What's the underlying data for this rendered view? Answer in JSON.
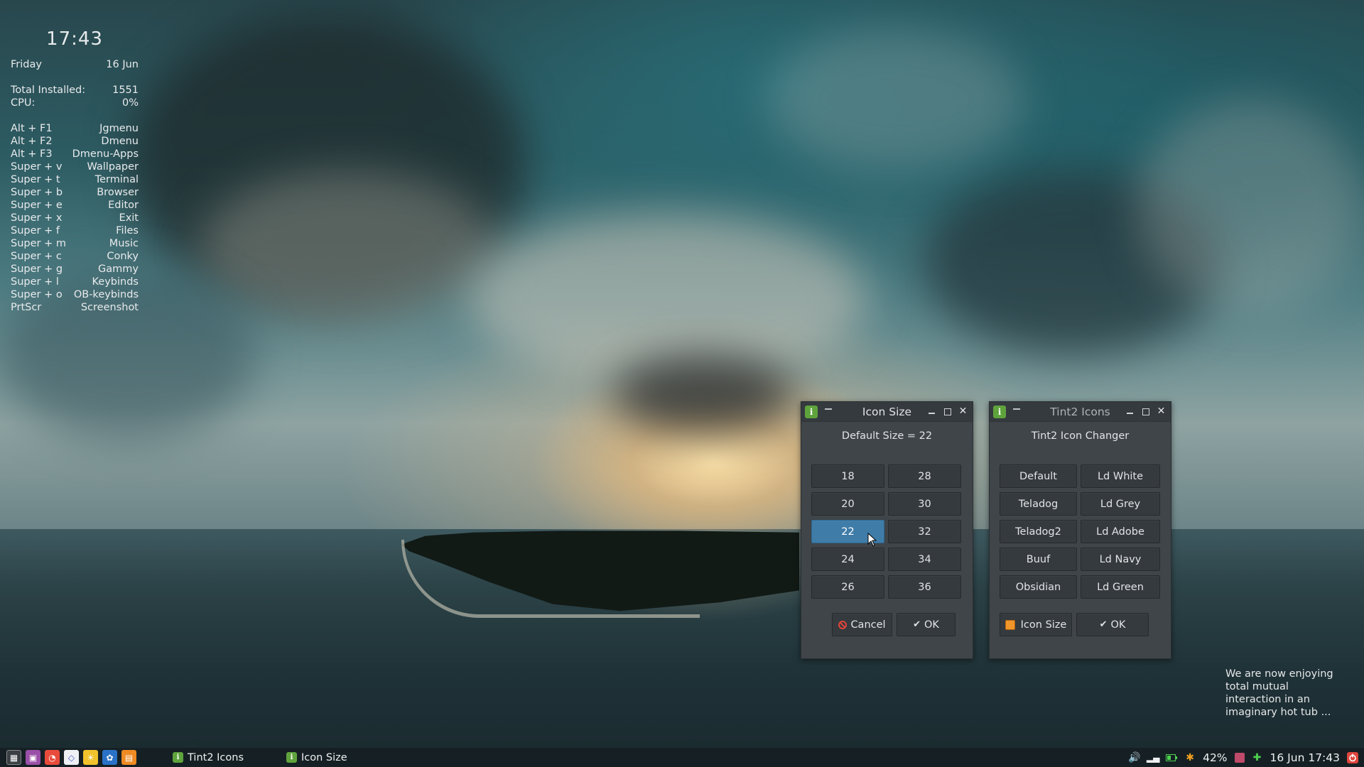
{
  "conky": {
    "time": "17:43",
    "day": "Friday",
    "date": "16 Jun",
    "stats": [
      {
        "label": "Total Installed:",
        "value": "1551"
      },
      {
        "label": "CPU:",
        "value": "0%"
      }
    ],
    "keybinds": [
      {
        "keys": "Alt + F1",
        "action": "Jgmenu"
      },
      {
        "keys": "Alt + F2",
        "action": "Dmenu"
      },
      {
        "keys": "Alt + F3",
        "action": "Dmenu-Apps"
      },
      {
        "keys": "Super + v",
        "action": "Wallpaper"
      },
      {
        "keys": "Super + t",
        "action": "Terminal"
      },
      {
        "keys": "Super + b",
        "action": "Browser"
      },
      {
        "keys": "Super + e",
        "action": "Editor"
      },
      {
        "keys": "Super + x",
        "action": "Exit"
      },
      {
        "keys": "Super + f",
        "action": "Files"
      },
      {
        "keys": "Super + m",
        "action": "Music"
      },
      {
        "keys": "Super + c",
        "action": "Conky"
      },
      {
        "keys": "Super + g",
        "action": "Gammy"
      },
      {
        "keys": "Super + l",
        "action": "Keybinds"
      },
      {
        "keys": "Super + o",
        "action": "OB-keybinds"
      },
      {
        "keys": "PrtScr",
        "action": "Screenshot"
      }
    ]
  },
  "icon_size_window": {
    "title": "Icon Size",
    "subtitle": "Default Size = 22",
    "sizes": [
      "18",
      "28",
      "20",
      "30",
      "22",
      "32",
      "24",
      "34",
      "26",
      "36"
    ],
    "selected": "22",
    "cancel_label": "Cancel",
    "ok_label": "OK"
  },
  "tint2_window": {
    "title": "Tint2 Icons",
    "subtitle": "Tint2 Icon Changer",
    "themes": [
      "Default",
      "Ld White",
      "Teladog",
      "Ld Grey",
      "Teladog2",
      "Ld Adobe",
      "Buuf",
      "Ld Navy",
      "Obsidian",
      "Ld Green"
    ],
    "icon_size_label": "Icon Size",
    "ok_label": "OK"
  },
  "quote": "We are now enjoying total mutual interaction in an imaginary hot tub ...",
  "taskbar": {
    "tasks": [
      {
        "label": "Tint2 Icons"
      },
      {
        "label": "Icon Size"
      }
    ],
    "battery": "42%",
    "clock": "16 Jun 17:43"
  },
  "colors": {
    "window_bg": "#3f4549",
    "titlebar": "#343a3e",
    "button": "#353a3e",
    "selected": "#3f7ca8",
    "app_icon": "#5fa33c"
  }
}
